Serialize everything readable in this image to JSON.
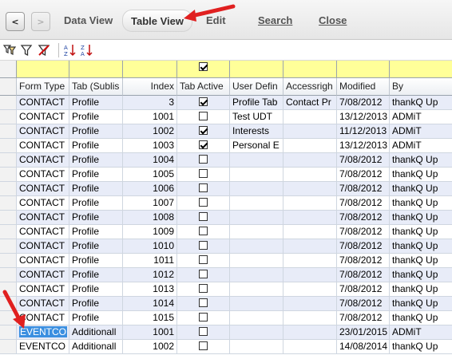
{
  "toolbar": {
    "back_label": "<",
    "forward_label": ">",
    "data_view": "Data View",
    "table_view": "Table View",
    "edit": "Edit",
    "search": "Search",
    "close": "Close"
  },
  "filter_row": {
    "tab_active_checked": true
  },
  "columns": {
    "form_type": "Form Type",
    "tab": "Tab (Sublis",
    "index": "Index",
    "tab_active": "Tab Active",
    "user_defined": "User Defin",
    "access_rights": "Accessrigh",
    "modified": "Modified",
    "by": "By"
  },
  "rows": [
    {
      "form_type": "CONTACT",
      "tab": "Profile",
      "index": "3",
      "active": true,
      "user_defined": "Profile Tab",
      "access": "Contact Pr",
      "modified": "7/08/2012",
      "by": "thankQ Up"
    },
    {
      "form_type": "CONTACT",
      "tab": "Profile",
      "index": "1001",
      "active": false,
      "user_defined": "Test UDT",
      "access": "",
      "modified": "13/12/2013",
      "by": "ADMiT"
    },
    {
      "form_type": "CONTACT",
      "tab": "Profile",
      "index": "1002",
      "active": true,
      "user_defined": "Interests",
      "access": "",
      "modified": "11/12/2013",
      "by": "ADMiT"
    },
    {
      "form_type": "CONTACT",
      "tab": "Profile",
      "index": "1003",
      "active": true,
      "user_defined": "Personal E",
      "access": "",
      "modified": "13/12/2013",
      "by": "ADMiT"
    },
    {
      "form_type": "CONTACT",
      "tab": "Profile",
      "index": "1004",
      "active": false,
      "user_defined": "",
      "access": "",
      "modified": "7/08/2012",
      "by": "thankQ Up"
    },
    {
      "form_type": "CONTACT",
      "tab": "Profile",
      "index": "1005",
      "active": false,
      "user_defined": "",
      "access": "",
      "modified": "7/08/2012",
      "by": "thankQ Up"
    },
    {
      "form_type": "CONTACT",
      "tab": "Profile",
      "index": "1006",
      "active": false,
      "user_defined": "",
      "access": "",
      "modified": "7/08/2012",
      "by": "thankQ Up"
    },
    {
      "form_type": "CONTACT",
      "tab": "Profile",
      "index": "1007",
      "active": false,
      "user_defined": "",
      "access": "",
      "modified": "7/08/2012",
      "by": "thankQ Up"
    },
    {
      "form_type": "CONTACT",
      "tab": "Profile",
      "index": "1008",
      "active": false,
      "user_defined": "",
      "access": "",
      "modified": "7/08/2012",
      "by": "thankQ Up"
    },
    {
      "form_type": "CONTACT",
      "tab": "Profile",
      "index": "1009",
      "active": false,
      "user_defined": "",
      "access": "",
      "modified": "7/08/2012",
      "by": "thankQ Up"
    },
    {
      "form_type": "CONTACT",
      "tab": "Profile",
      "index": "1010",
      "active": false,
      "user_defined": "",
      "access": "",
      "modified": "7/08/2012",
      "by": "thankQ Up"
    },
    {
      "form_type": "CONTACT",
      "tab": "Profile",
      "index": "1011",
      "active": false,
      "user_defined": "",
      "access": "",
      "modified": "7/08/2012",
      "by": "thankQ Up"
    },
    {
      "form_type": "CONTACT",
      "tab": "Profile",
      "index": "1012",
      "active": false,
      "user_defined": "",
      "access": "",
      "modified": "7/08/2012",
      "by": "thankQ Up"
    },
    {
      "form_type": "CONTACT",
      "tab": "Profile",
      "index": "1013",
      "active": false,
      "user_defined": "",
      "access": "",
      "modified": "7/08/2012",
      "by": "thankQ Up"
    },
    {
      "form_type": "CONTACT",
      "tab": "Profile",
      "index": "1014",
      "active": false,
      "user_defined": "",
      "access": "",
      "modified": "7/08/2012",
      "by": "thankQ Up"
    },
    {
      "form_type": "CONTACT",
      "tab": "Profile",
      "index": "1015",
      "active": false,
      "user_defined": "",
      "access": "",
      "modified": "7/08/2012",
      "by": "thankQ Up"
    },
    {
      "form_type": "EVENTCO",
      "tab": "Additionall",
      "index": "1001",
      "active": false,
      "user_defined": "",
      "access": "",
      "modified": "23/01/2015",
      "by": "ADMiT",
      "selected": true
    },
    {
      "form_type": "EVENTCO",
      "tab": "Additionall",
      "index": "1002",
      "active": false,
      "user_defined": "",
      "access": "",
      "modified": "14/08/2014",
      "by": "thankQ Up"
    }
  ],
  "colors": {
    "row_alt": "#e8ecf8",
    "filter_row": "#ffff99",
    "selection": "#3b8fe0",
    "annotation_arrow": "#e02020"
  },
  "icons": [
    "filter-options-icon",
    "filter-icon",
    "clear-filter-icon",
    "sort-ascending-icon",
    "sort-descending-icon"
  ]
}
